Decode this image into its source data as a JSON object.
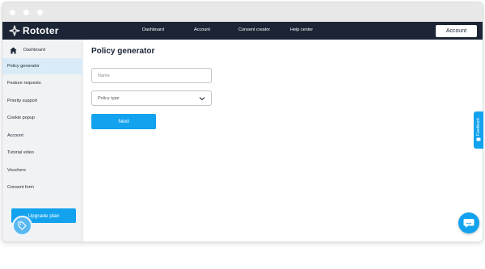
{
  "brand": {
    "name": "Rototer"
  },
  "nav": {
    "links": [
      "Dashboard",
      "Account",
      "Consent creator",
      "Help center"
    ],
    "account_button": "Account"
  },
  "sidebar": {
    "items": [
      {
        "label": "Dashboard",
        "icon": "home-icon",
        "active": false
      },
      {
        "label": "Policy generator",
        "active": true
      },
      {
        "label": "Feature requests",
        "active": false
      },
      {
        "label": "Priority support",
        "active": false
      },
      {
        "label": "Cookie popup",
        "active": false
      },
      {
        "label": "Account",
        "active": false
      },
      {
        "label": "Tutorial video",
        "active": false
      },
      {
        "label": "Vouchers",
        "active": false
      },
      {
        "label": "Consent form",
        "active": false
      }
    ],
    "upgrade_button": "Upgrade plan"
  },
  "main": {
    "title": "Policy generator",
    "name_input": {
      "placeholder": "Name",
      "value": ""
    },
    "policy_type_select": {
      "placeholder": "Policy type"
    },
    "next_button": "Next"
  },
  "feedback_tab": {
    "label": "Feedback"
  },
  "colors": {
    "navbar": "#1b2535",
    "accent": "#12a2ee",
    "sidebar_active": "#d9ebf7",
    "sidebar_bg": "#f1f2f4"
  }
}
